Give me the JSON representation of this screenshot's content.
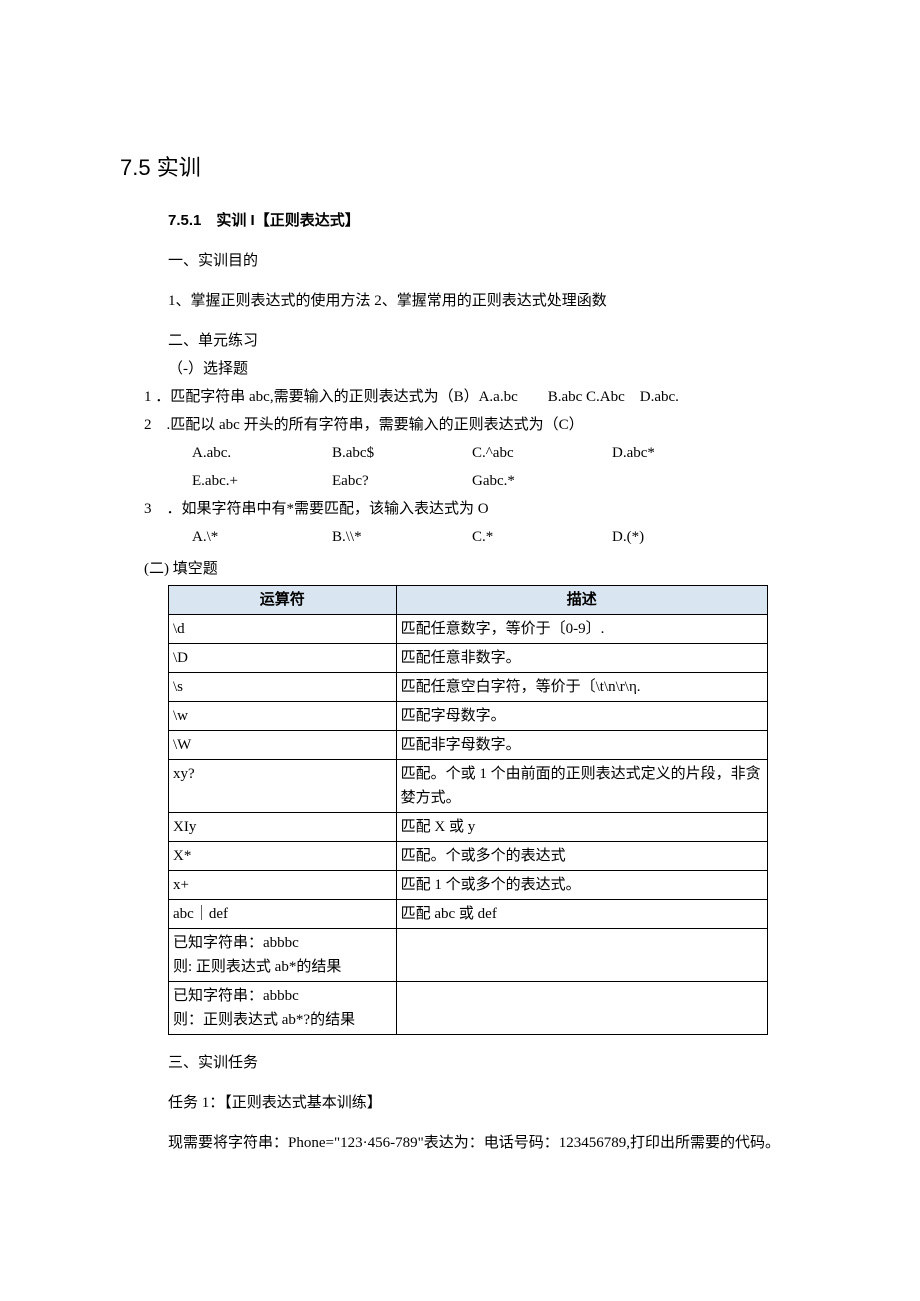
{
  "section_title": "7.5 实训",
  "subsection_title": "7.5.1　实训 I【正则表达式】",
  "purpose_heading": "一、实训目的",
  "purpose_text": "1、掌握正则表达式的使用方法 2、掌握常用的正则表达式处理函数",
  "exercise_heading": "二、单元练习",
  "mc_heading": "（-）选择题",
  "q1": "1 ．匹配字符串 abc,需要输入的正则表达式为（B）A.a.bc　　B.abc C.Abc　D.abc.",
  "q2": "2　.匹配以 abc 开头的所有字符串，需要输入的正则表达式为（C）",
  "q2_row1": {
    "a": "A.abc.",
    "b": "B.abc$",
    "c": "C.^abc",
    "d": "D.abc*"
  },
  "q2_row2": {
    "a": "E.abc.+",
    "b": "Eabc?",
    "c": "Gabc.*",
    "d": ""
  },
  "q3": "3　．如果字符串中有*需要匹配，该输入表达式为 O",
  "q3_row1": {
    "a": "A.\\*",
    "b": "B.\\\\*",
    "c": "C.*",
    "d": "D.(*)"
  },
  "fill_heading": "(二) 填空题",
  "table": {
    "headers": {
      "col1": "运算符",
      "col2": "描述"
    },
    "rows": [
      {
        "c1": "\\d",
        "c2": "匹配任意数字，等价于〔0-9〕."
      },
      {
        "c1": "\\D",
        "c2": "匹配任意非数字。"
      },
      {
        "c1": "\\s",
        "c2": "匹配任意空白字符，等价于〔\\t\\n\\r\\η."
      },
      {
        "c1": "\\w",
        "c2": "匹配字母数字。"
      },
      {
        "c1": "\\W",
        "c2": "匹配非字母数字。"
      },
      {
        "c1": "xy?",
        "c2": "匹配。个或 1 个由前面的正则表达式定义的片段，非贪婪方式。"
      },
      {
        "c1": "XIy",
        "c2": "匹配 X 或 y"
      },
      {
        "c1": "X*",
        "c2": "匹配。个或多个的表达式"
      },
      {
        "c1": "x+",
        "c2": "匹配 1 个或多个的表达式。"
      },
      {
        "c1": "abc｜def",
        "c2": "匹配 abc 或 def"
      },
      {
        "c1": "已知字符串：abbbc\n则: 正则表达式 ab*的结果",
        "c2": ""
      },
      {
        "c1": "已知字符串：abbbc\n则：正则表达式 ab*?的结果",
        "c2": ""
      }
    ]
  },
  "task_heading": "三、实训任务",
  "task_label": "任务 1：【正则表达式基本训练】",
  "task_text": "现需要将字符串：Phone=\"123·456-789\"表达为：电话号码：123456789,打印出所需要的代码。"
}
